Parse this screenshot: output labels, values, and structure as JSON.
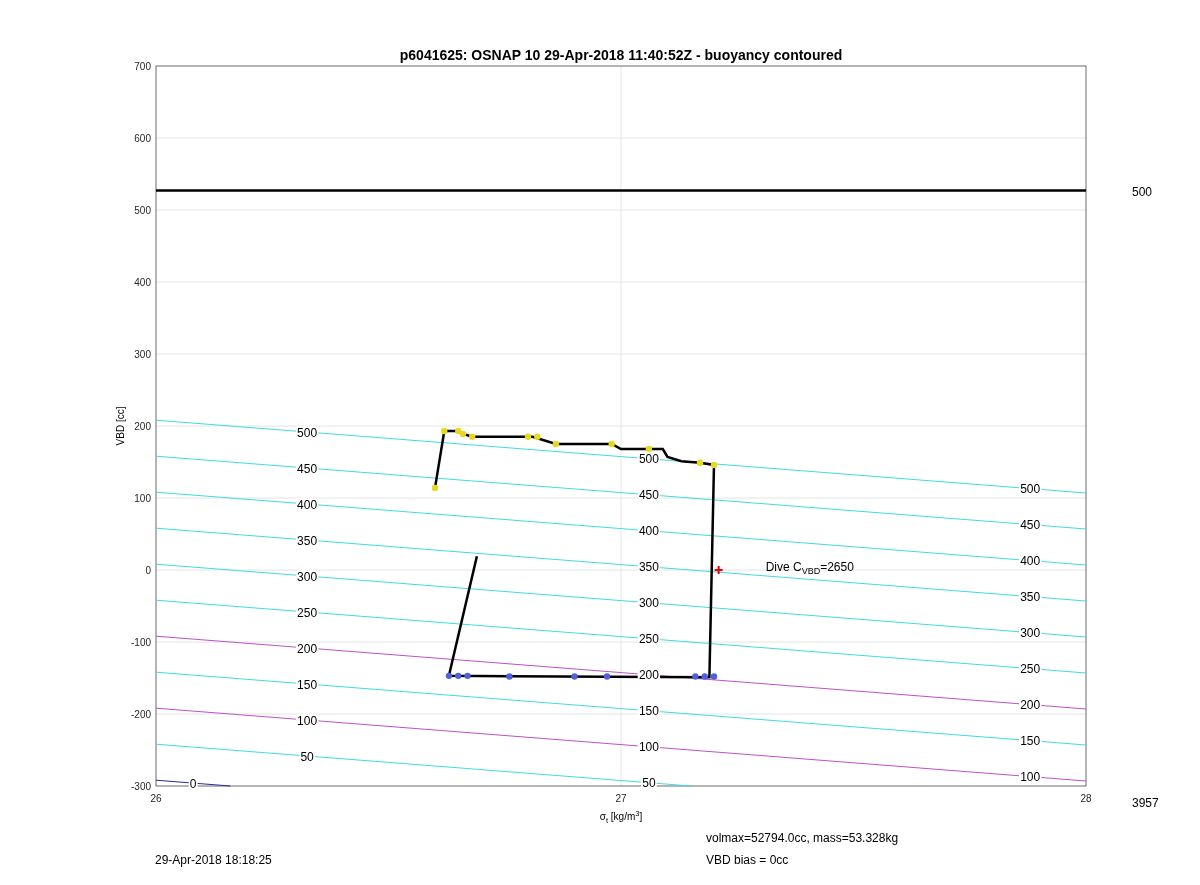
{
  "figure": {
    "chart_data": {
      "type": "line",
      "title": "p6041625: OSNAP 10 29-Apr-2018 11:40:52Z - buoyancy contoured",
      "xlabel": "σ$_{t}$ [kg/m$^{3}$]",
      "ylabel": "VBD [cc]",
      "xlim": [
        26,
        28
      ],
      "ylim": [
        -300,
        700
      ],
      "xticks": [
        26,
        27,
        28
      ],
      "yticks": [
        -300,
        -200,
        -100,
        0,
        100,
        200,
        300,
        400,
        500,
        600,
        700
      ],
      "grid": true,
      "series": [
        {
          "color": "#2828a8",
          "x": [
            26,
            26.16
          ],
          "values": [
            -292,
            -300
          ]
        },
        {
          "color": "#40dcdc",
          "x": [
            26,
            27.15
          ],
          "values": [
            -242,
            -300
          ]
        },
        {
          "color": "#c050c8",
          "x": [
            26,
            28
          ],
          "values": [
            -192,
            -293
          ]
        },
        {
          "color": "#40dcdc",
          "x": [
            26,
            28
          ],
          "values": [
            -142,
            -243
          ]
        },
        {
          "color": "#c050c8",
          "x": [
            26,
            28
          ],
          "values": [
            -92,
            -193
          ]
        },
        {
          "color": "#40dcdc",
          "x": [
            26,
            28
          ],
          "values": [
            -42,
            -143
          ]
        },
        {
          "color": "#40dcdc",
          "x": [
            26,
            28
          ],
          "values": [
            8,
            -93
          ]
        },
        {
          "color": "#40dcdc",
          "x": [
            26,
            28
          ],
          "values": [
            58,
            -43
          ]
        },
        {
          "color": "#40dcdc",
          "x": [
            26,
            28
          ],
          "values": [
            108,
            7
          ]
        },
        {
          "color": "#40dcdc",
          "x": [
            26,
            28
          ],
          "values": [
            158,
            57
          ]
        },
        {
          "color": "#40dcdc",
          "x": [
            26,
            28
          ],
          "values": [
            208,
            107
          ]
        },
        {
          "color": "#000000",
          "x": [
            26,
            28
          ],
          "values": [
            527,
            527
          ]
        },
        {
          "color": "#000000",
          "x": [
            26.6,
            26.62,
            26.65,
            26.66,
            26.68,
            26.81,
            26.86,
            26.98,
            27,
            27.09,
            27.1,
            27.13,
            27.17,
            27.2,
            27.19,
            26.63,
            26.69
          ],
          "values": [
            114,
            193,
            193,
            189,
            185,
            185,
            175,
            175,
            168,
            168,
            157,
            151,
            149,
            146,
            -149,
            -147,
            19
          ]
        },
        {
          "type": "scatter",
          "marker": "circle",
          "color": "#e8d820",
          "x": [
            26.6,
            26.62,
            26.65,
            26.66,
            26.68,
            26.8,
            26.82,
            26.86,
            26.98,
            27.06,
            27.17,
            27.2
          ],
          "values": [
            114,
            193,
            193,
            189,
            185,
            185,
            185,
            175,
            175,
            168,
            149,
            146
          ]
        },
        {
          "type": "scatter",
          "marker": "circle",
          "color": "#5060d8",
          "x": [
            26.63,
            26.65,
            26.67,
            26.76,
            26.9,
            26.97,
            27.16,
            27.18,
            27.2
          ],
          "values": [
            -147,
            -147,
            -147,
            -148,
            -148,
            -148,
            -148,
            -148,
            -148
          ]
        },
        {
          "type": "scatter",
          "marker": "cross",
          "color": "#ee0000",
          "x": [
            27.21
          ],
          "values": [
            0
          ]
        }
      ]
    },
    "dive_note": "Dive C$_{VBD}$=2650",
    "limit_label": "500",
    "contour_labels": [
      [
        "500",
        "450",
        "400",
        "350",
        "300",
        "250",
        "200",
        "150",
        "100",
        "50",
        "0"
      ],
      [
        "500",
        "450",
        "400",
        "350",
        "300",
        "250",
        "200",
        "150",
        "100",
        "50"
      ],
      [
        "500",
        "450",
        "400",
        "350",
        "300",
        "250",
        "200",
        "150",
        "100"
      ]
    ],
    "corner_number": "3957",
    "footer": {
      "timestamp": "29-Apr-2018 18:18:25",
      "volmax": "volmax=52794.0cc, mass=53.328kg",
      "bias": "VBD bias = 0cc"
    }
  }
}
